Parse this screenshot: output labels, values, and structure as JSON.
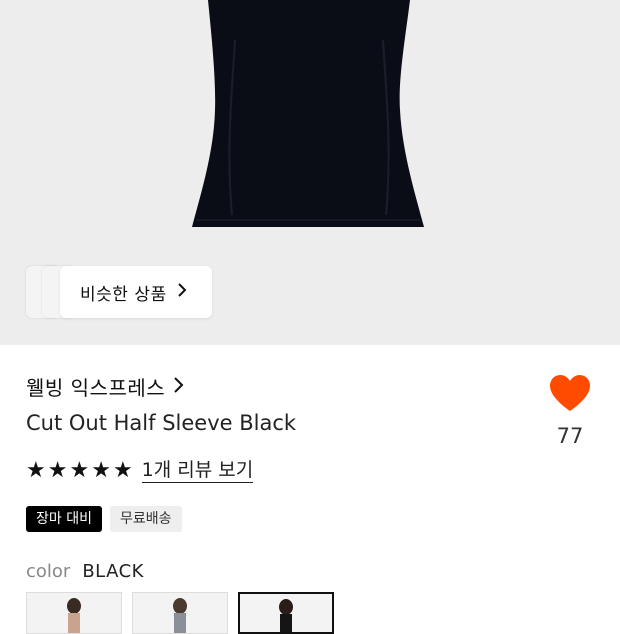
{
  "hero": {
    "background": "#ededed",
    "similar_products_label": "비슷한 상품"
  },
  "product": {
    "brand": "웰빙 익스프레스",
    "title": "Cut Out Half Sleeve Black",
    "like_count": "77",
    "like_color": "#ff4b00",
    "rating_stars": 5,
    "review_link": "1개 리뷰 보기",
    "badges": [
      "장마 대비",
      "무료배송"
    ],
    "color_label": "color",
    "color_value": "BLACK"
  },
  "icons": {
    "chevron": "chevron-right-icon",
    "heart": "heart-icon",
    "star": "star-icon"
  }
}
